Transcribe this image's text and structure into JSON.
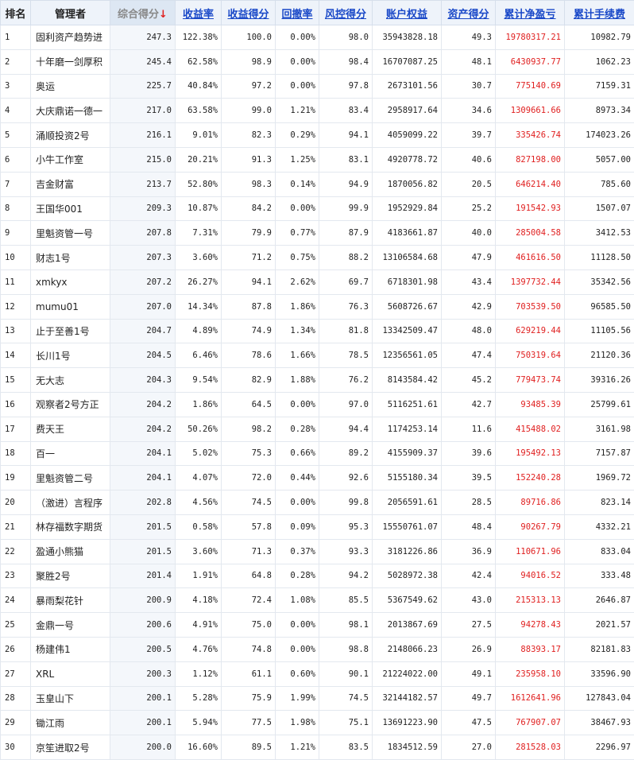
{
  "headers": {
    "rank": "排名",
    "manager": "管理者",
    "total_score": "综合得分",
    "sort_arrow": "↓",
    "return_rate": "收益率",
    "return_score": "收益得分",
    "drawdown": "回撤率",
    "risk_score": "风控得分",
    "equity": "账户权益",
    "asset_score": "资产得分",
    "cum_pnl": "累计净盈亏",
    "cum_fee": "累计手续费"
  },
  "rows": [
    {
      "rank": "1",
      "manager": "固利资产趋势进",
      "total": "247.3",
      "ret": "122.38%",
      "ret_score": "100.0",
      "dd": "0.00%",
      "risk": "98.0",
      "equity": "35943828.18",
      "asset": "49.3",
      "pnl": "19780317.21",
      "fee": "10982.79"
    },
    {
      "rank": "2",
      "manager": "十年磨一剑厚积",
      "total": "245.4",
      "ret": "62.58%",
      "ret_score": "98.9",
      "dd": "0.00%",
      "risk": "98.4",
      "equity": "16707087.25",
      "asset": "48.1",
      "pnl": "6430937.77",
      "fee": "1062.23"
    },
    {
      "rank": "3",
      "manager": "奥运",
      "total": "225.7",
      "ret": "40.84%",
      "ret_score": "97.2",
      "dd": "0.00%",
      "risk": "97.8",
      "equity": "2673101.56",
      "asset": "30.7",
      "pnl": "775140.69",
      "fee": "7159.31"
    },
    {
      "rank": "4",
      "manager": "大庆鼎诺一德一",
      "total": "217.0",
      "ret": "63.58%",
      "ret_score": "99.0",
      "dd": "1.21%",
      "risk": "83.4",
      "equity": "2958917.64",
      "asset": "34.6",
      "pnl": "1309661.66",
      "fee": "8973.34"
    },
    {
      "rank": "5",
      "manager": "涌顺投资2号",
      "total": "216.1",
      "ret": "9.01%",
      "ret_score": "82.3",
      "dd": "0.29%",
      "risk": "94.1",
      "equity": "4059099.22",
      "asset": "39.7",
      "pnl": "335426.74",
      "fee": "174023.26"
    },
    {
      "rank": "6",
      "manager": "小牛工作室",
      "total": "215.0",
      "ret": "20.21%",
      "ret_score": "91.3",
      "dd": "1.25%",
      "risk": "83.1",
      "equity": "4920778.72",
      "asset": "40.6",
      "pnl": "827198.00",
      "fee": "5057.00"
    },
    {
      "rank": "7",
      "manager": "吉金财富",
      "total": "213.7",
      "ret": "52.80%",
      "ret_score": "98.3",
      "dd": "0.14%",
      "risk": "94.9",
      "equity": "1870056.82",
      "asset": "20.5",
      "pnl": "646214.40",
      "fee": "785.60"
    },
    {
      "rank": "8",
      "manager": "王国华001",
      "total": "209.3",
      "ret": "10.87%",
      "ret_score": "84.2",
      "dd": "0.00%",
      "risk": "99.9",
      "equity": "1952929.84",
      "asset": "25.2",
      "pnl": "191542.93",
      "fee": "1507.07"
    },
    {
      "rank": "9",
      "manager": "里魁资管一号",
      "total": "207.8",
      "ret": "7.31%",
      "ret_score": "79.9",
      "dd": "0.77%",
      "risk": "87.9",
      "equity": "4183661.87",
      "asset": "40.0",
      "pnl": "285004.58",
      "fee": "3412.53"
    },
    {
      "rank": "10",
      "manager": "财志1号",
      "total": "207.3",
      "ret": "3.60%",
      "ret_score": "71.2",
      "dd": "0.75%",
      "risk": "88.2",
      "equity": "13106584.68",
      "asset": "47.9",
      "pnl": "461616.50",
      "fee": "11128.50"
    },
    {
      "rank": "11",
      "manager": "xmkyx",
      "total": "207.2",
      "ret": "26.27%",
      "ret_score": "94.1",
      "dd": "2.62%",
      "risk": "69.7",
      "equity": "6718301.98",
      "asset": "43.4",
      "pnl": "1397732.44",
      "fee": "35342.56"
    },
    {
      "rank": "12",
      "manager": "mumu01",
      "total": "207.0",
      "ret": "14.34%",
      "ret_score": "87.8",
      "dd": "1.86%",
      "risk": "76.3",
      "equity": "5608726.67",
      "asset": "42.9",
      "pnl": "703539.50",
      "fee": "96585.50"
    },
    {
      "rank": "13",
      "manager": "止于至善1号",
      "total": "204.7",
      "ret": "4.89%",
      "ret_score": "74.9",
      "dd": "1.34%",
      "risk": "81.8",
      "equity": "13342509.47",
      "asset": "48.0",
      "pnl": "629219.44",
      "fee": "11105.56"
    },
    {
      "rank": "14",
      "manager": "长川1号",
      "total": "204.5",
      "ret": "6.46%",
      "ret_score": "78.6",
      "dd": "1.66%",
      "risk": "78.5",
      "equity": "12356561.05",
      "asset": "47.4",
      "pnl": "750319.64",
      "fee": "21120.36"
    },
    {
      "rank": "15",
      "manager": "无大志",
      "total": "204.3",
      "ret": "9.54%",
      "ret_score": "82.9",
      "dd": "1.88%",
      "risk": "76.2",
      "equity": "8143584.42",
      "asset": "45.2",
      "pnl": "779473.74",
      "fee": "39316.26"
    },
    {
      "rank": "16",
      "manager": "观察者2号方正",
      "total": "204.2",
      "ret": "1.86%",
      "ret_score": "64.5",
      "dd": "0.00%",
      "risk": "97.0",
      "equity": "5116251.61",
      "asset": "42.7",
      "pnl": "93485.39",
      "fee": "25799.61"
    },
    {
      "rank": "17",
      "manager": "费天王",
      "total": "204.2",
      "ret": "50.26%",
      "ret_score": "98.2",
      "dd": "0.28%",
      "risk": "94.4",
      "equity": "1174253.14",
      "asset": "11.6",
      "pnl": "415488.02",
      "fee": "3161.98"
    },
    {
      "rank": "18",
      "manager": "百一",
      "total": "204.1",
      "ret": "5.02%",
      "ret_score": "75.3",
      "dd": "0.66%",
      "risk": "89.2",
      "equity": "4155909.37",
      "asset": "39.6",
      "pnl": "195492.13",
      "fee": "7157.87"
    },
    {
      "rank": "19",
      "manager": "里魁资管二号",
      "total": "204.1",
      "ret": "4.07%",
      "ret_score": "72.0",
      "dd": "0.44%",
      "risk": "92.6",
      "equity": "5155180.34",
      "asset": "39.5",
      "pnl": "152240.28",
      "fee": "1969.72"
    },
    {
      "rank": "20",
      "manager": "（激进）言程序",
      "total": "202.8",
      "ret": "4.56%",
      "ret_score": "74.5",
      "dd": "0.00%",
      "risk": "99.8",
      "equity": "2056591.61",
      "asset": "28.5",
      "pnl": "89716.86",
      "fee": "823.14"
    },
    {
      "rank": "21",
      "manager": "林存福数字期货",
      "total": "201.5",
      "ret": "0.58%",
      "ret_score": "57.8",
      "dd": "0.09%",
      "risk": "95.3",
      "equity": "15550761.07",
      "asset": "48.4",
      "pnl": "90267.79",
      "fee": "4332.21"
    },
    {
      "rank": "22",
      "manager": "盈通小熊猫",
      "total": "201.5",
      "ret": "3.60%",
      "ret_score": "71.3",
      "dd": "0.37%",
      "risk": "93.3",
      "equity": "3181226.86",
      "asset": "36.9",
      "pnl": "110671.96",
      "fee": "833.04"
    },
    {
      "rank": "23",
      "manager": "聚胜2号",
      "total": "201.4",
      "ret": "1.91%",
      "ret_score": "64.8",
      "dd": "0.28%",
      "risk": "94.2",
      "equity": "5028972.38",
      "asset": "42.4",
      "pnl": "94016.52",
      "fee": "333.48"
    },
    {
      "rank": "24",
      "manager": "暴雨梨花针",
      "total": "200.9",
      "ret": "4.18%",
      "ret_score": "72.4",
      "dd": "1.08%",
      "risk": "85.5",
      "equity": "5367549.62",
      "asset": "43.0",
      "pnl": "215313.13",
      "fee": "2646.87"
    },
    {
      "rank": "25",
      "manager": "金鼎一号",
      "total": "200.6",
      "ret": "4.91%",
      "ret_score": "75.0",
      "dd": "0.00%",
      "risk": "98.1",
      "equity": "2013867.69",
      "asset": "27.5",
      "pnl": "94278.43",
      "fee": "2021.57"
    },
    {
      "rank": "26",
      "manager": "杨建伟1",
      "total": "200.5",
      "ret": "4.76%",
      "ret_score": "74.8",
      "dd": "0.00%",
      "risk": "98.8",
      "equity": "2148066.23",
      "asset": "26.9",
      "pnl": "88393.17",
      "fee": "82181.83"
    },
    {
      "rank": "27",
      "manager": "XRL",
      "total": "200.3",
      "ret": "1.12%",
      "ret_score": "61.1",
      "dd": "0.60%",
      "risk": "90.1",
      "equity": "21224022.00",
      "asset": "49.1",
      "pnl": "235958.10",
      "fee": "33596.90"
    },
    {
      "rank": "28",
      "manager": "玉皇山下",
      "total": "200.1",
      "ret": "5.28%",
      "ret_score": "75.9",
      "dd": "1.99%",
      "risk": "74.5",
      "equity": "32144182.57",
      "asset": "49.7",
      "pnl": "1612641.96",
      "fee": "127843.04"
    },
    {
      "rank": "29",
      "manager": "锄江雨",
      "total": "200.1",
      "ret": "5.94%",
      "ret_score": "77.5",
      "dd": "1.98%",
      "risk": "75.1",
      "equity": "13691223.90",
      "asset": "47.5",
      "pnl": "767907.07",
      "fee": "38467.93"
    },
    {
      "rank": "30",
      "manager": "京笙进取2号",
      "total": "200.0",
      "ret": "16.60%",
      "ret_score": "89.5",
      "dd": "1.21%",
      "risk": "83.5",
      "equity": "1834512.59",
      "asset": "27.0",
      "pnl": "281528.03",
      "fee": "2296.97"
    }
  ]
}
